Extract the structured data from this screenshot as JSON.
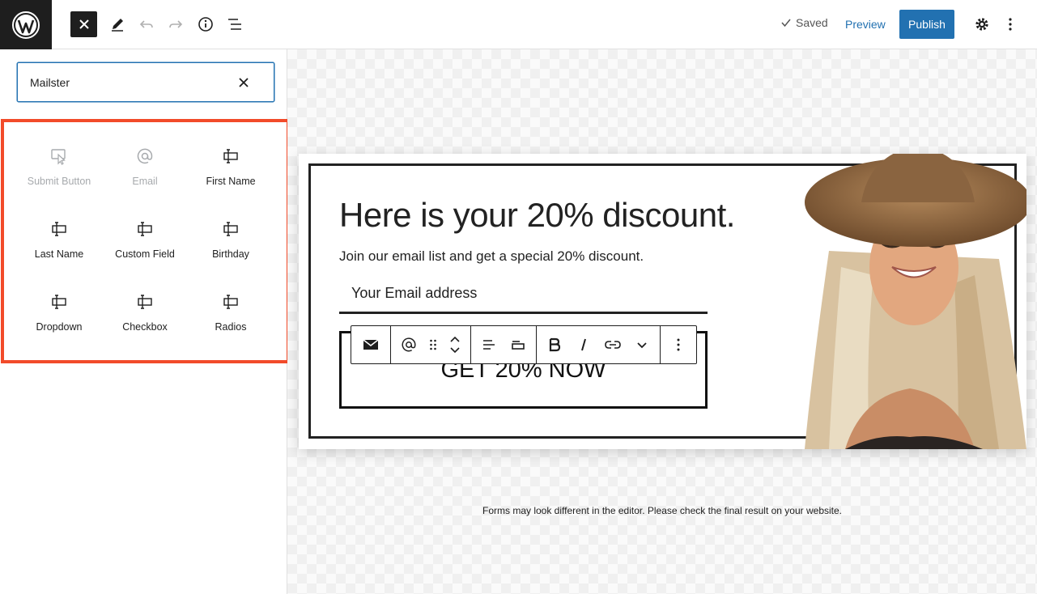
{
  "topbar": {
    "saved_label": "Saved",
    "preview_label": "Preview",
    "publish_label": "Publish"
  },
  "inserter": {
    "search_value": "Mailster",
    "blocks": [
      {
        "label": "Submit Button",
        "icon": "pointer-icon",
        "disabled": true
      },
      {
        "label": "Email",
        "icon": "at-icon",
        "disabled": true
      },
      {
        "label": "First Name",
        "icon": "field-icon",
        "disabled": false
      },
      {
        "label": "Last Name",
        "icon": "field-icon",
        "disabled": false
      },
      {
        "label": "Custom Field",
        "icon": "field-icon",
        "disabled": false
      },
      {
        "label": "Birthday",
        "icon": "field-icon",
        "disabled": false
      },
      {
        "label": "Dropdown",
        "icon": "field-icon",
        "disabled": false
      },
      {
        "label": "Checkbox",
        "icon": "field-icon",
        "disabled": false
      },
      {
        "label": "Radios",
        "icon": "field-icon",
        "disabled": false
      }
    ]
  },
  "form": {
    "headline": "Here is your 20% discount.",
    "subline": "Join our email list and get a special 20% discount.",
    "email_placeholder": "Your Email address",
    "cta_label": "GET 20% NOW"
  },
  "canvas": {
    "note": "Forms may look different in the editor. Please check the final result on your website."
  },
  "colors": {
    "accent": "#2271b1",
    "highlight": "#f24b2a",
    "dark": "#1e1e1e"
  }
}
